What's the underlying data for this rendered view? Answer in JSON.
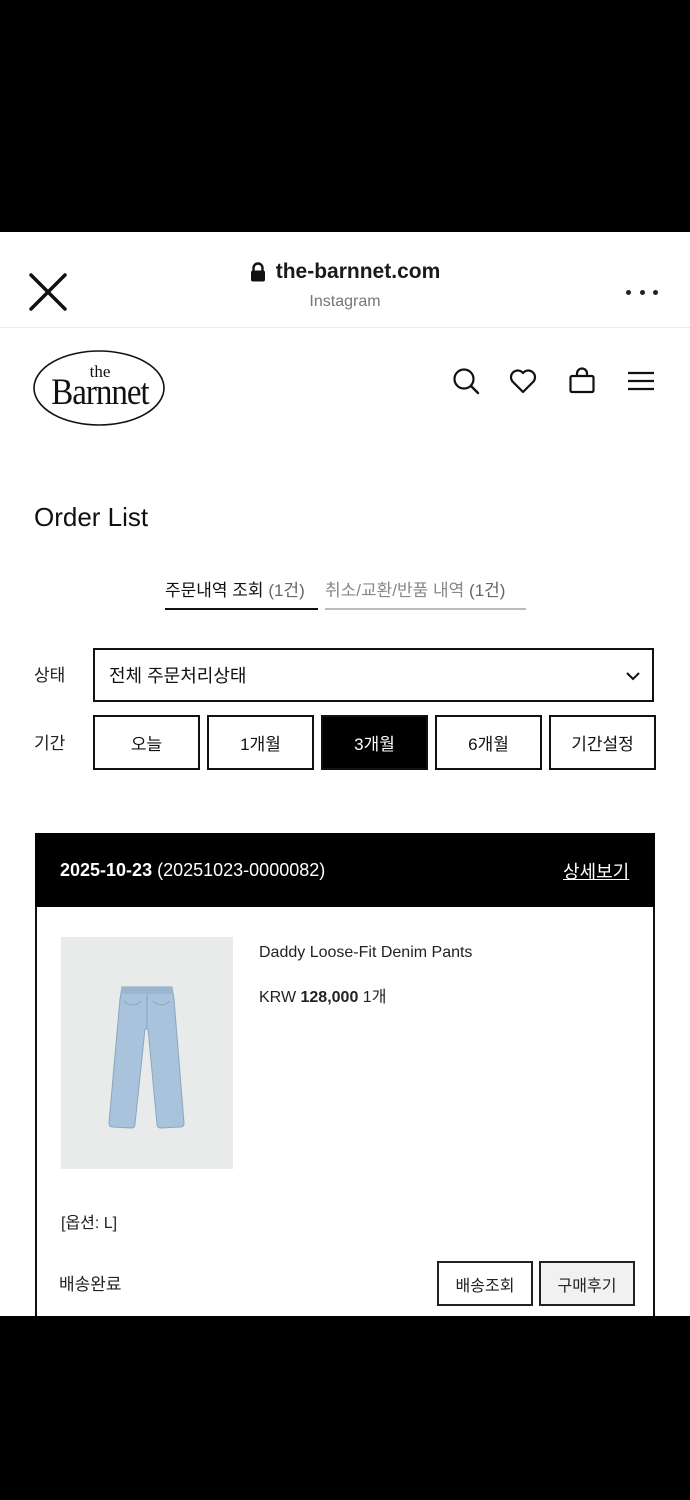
{
  "browser": {
    "url": "the-barnnet.com",
    "source": "Instagram"
  },
  "site": {
    "logo_small": "the",
    "logo_name": "Barnnet"
  },
  "page": {
    "title": "Order List"
  },
  "tabs": [
    {
      "label": "주문내역 조회",
      "count": "(1건)"
    },
    {
      "label": "취소/교환/반품 내역",
      "count": "(1건)"
    }
  ],
  "filters": {
    "status_label": "상태",
    "status_value": "전체 주문처리상태",
    "period_label": "기간",
    "periods": [
      "오늘",
      "1개월",
      "3개월",
      "6개월",
      "기간설정"
    ],
    "active_period": "3개월"
  },
  "order": {
    "date": "2025-10-23",
    "number": "(20251023-0000082)",
    "detail_link": "상세보기",
    "product_name": "Daddy Loose-Fit Denim Pants",
    "currency": "KRW",
    "price": "128,000",
    "quantity": "1개",
    "option": "[옵션: L]",
    "status": "배송완료",
    "track_button": "배송조회",
    "review_button": "구매후기"
  },
  "colors": {
    "accent": "#000000",
    "denim": "#a9c3dc",
    "image_bg": "#e9eaea"
  },
  "icons": [
    "close-icon",
    "lock-icon",
    "more-icon",
    "search-icon",
    "heart-icon",
    "bag-icon",
    "menu-icon",
    "chevron-down-icon"
  ]
}
